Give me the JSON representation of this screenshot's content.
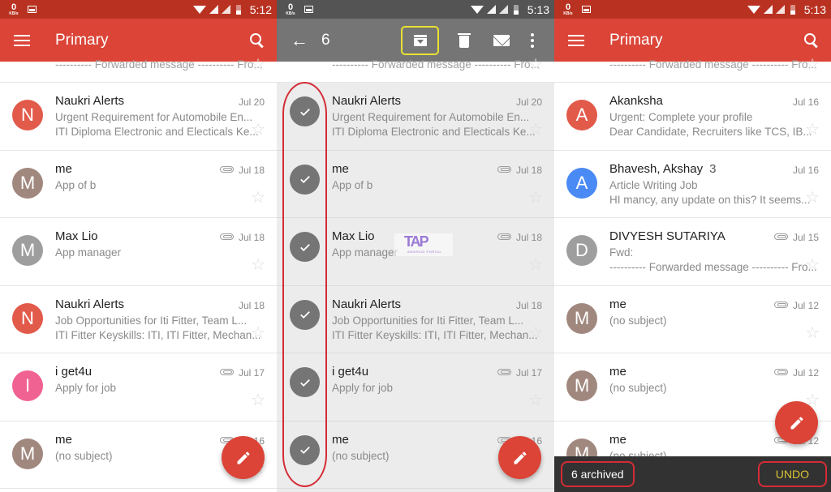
{
  "colors": {
    "primary_red": "#db4437",
    "status_red": "#b93221",
    "selection_gray": "#757575",
    "highlight_yellow": "#e8e231",
    "annotation_red": "#d42c36",
    "undo_yellow": "#d8c232"
  },
  "screens": [
    {
      "status": {
        "net_speed": "0",
        "net_unit": "KB/s",
        "time": "5:12"
      },
      "appbar": {
        "title": "Primary",
        "menu_icon": "hamburger-menu-icon",
        "search_icon": "search-icon"
      },
      "peek": {
        "text": "---------- Forwarded message ---------- Fro..."
      },
      "rows": [
        {
          "initial": "N",
          "color": "#e25a4a",
          "sender": "Naukri Alerts",
          "date": "Jul 20",
          "attachment": false,
          "subject": "Urgent Requirement for Automobile En...",
          "snippet": "ITI Diploma Electronic and Electicals Ke..."
        },
        {
          "initial": "M",
          "color": "#a1887f",
          "sender": "me",
          "date": "Jul 18",
          "attachment": true,
          "subject": "App of b",
          "snippet": ""
        },
        {
          "initial": "M",
          "color": "#9e9e9e",
          "sender": "Max Lio",
          "date": "Jul 18",
          "attachment": true,
          "subject": "App manager",
          "snippet": ""
        },
        {
          "initial": "N",
          "color": "#e25a4a",
          "sender": "Naukri Alerts",
          "date": "Jul 18",
          "attachment": false,
          "subject": "Job Opportunities for Iti Fitter, Team L...",
          "snippet": "ITI Fitter Keyskills: ITI, ITI Fitter, Mechan..."
        },
        {
          "initial": "I",
          "color": "#f06292",
          "sender": "i get4u",
          "date": "Jul 17",
          "attachment": true,
          "subject": "Apply for job",
          "snippet": ""
        },
        {
          "initial": "M",
          "color": "#a1887f",
          "sender": "me",
          "date": "Jul 16",
          "attachment": true,
          "subject": "(no subject)",
          "snippet": ""
        }
      ]
    },
    {
      "status": {
        "net_speed": "0",
        "net_unit": "KB/s",
        "time": "5:13"
      },
      "appbar": {
        "selected_count": "6",
        "back_icon": "arrow-back-icon",
        "actions": [
          "archive-icon",
          "delete-icon",
          "mark-unread-icon",
          "more-vert-icon"
        ]
      },
      "peek": {
        "text": "---------- Forwarded message ---------- Fro..."
      },
      "watermark": {
        "big": "TAP",
        "small": "ANDROID PORTAL"
      },
      "rows": [
        {
          "selected": true,
          "sender": "Naukri Alerts",
          "date": "Jul 20",
          "attachment": false,
          "subject": "Urgent Requirement for Automobile En...",
          "snippet": "ITI Diploma Electronic and Electicals Ke..."
        },
        {
          "selected": true,
          "sender": "me",
          "date": "Jul 18",
          "attachment": true,
          "subject": "App of b",
          "snippet": ""
        },
        {
          "selected": true,
          "sender": "Max Lio",
          "date": "Jul 18",
          "attachment": true,
          "subject": "App manager",
          "snippet": ""
        },
        {
          "selected": true,
          "sender": "Naukri Alerts",
          "date": "Jul 18",
          "attachment": false,
          "subject": "Job Opportunities for Iti Fitter, Team L...",
          "snippet": "ITI Fitter Keyskills: ITI, ITI Fitter, Mechan..."
        },
        {
          "selected": true,
          "sender": "i get4u",
          "date": "Jul 17",
          "attachment": true,
          "subject": "Apply for job",
          "snippet": ""
        },
        {
          "selected": true,
          "sender": "me",
          "date": "Jul 16",
          "attachment": true,
          "subject": "(no subject)",
          "snippet": ""
        }
      ]
    },
    {
      "status": {
        "net_speed": "0",
        "net_unit": "KB/s",
        "time": "5:13"
      },
      "appbar": {
        "title": "Primary",
        "menu_icon": "hamburger-menu-icon",
        "search_icon": "search-icon"
      },
      "peek": {
        "text": "---------- Forwarded message ---------- Fro..."
      },
      "rows": [
        {
          "initial": "A",
          "color": "#e25a4a",
          "sender": "Akanksha",
          "count": "",
          "date": "Jul 16",
          "attachment": false,
          "subject": "Urgent: Complete your profile",
          "snippet": "Dear Candidate, Recruiters like TCS, IB..."
        },
        {
          "initial": "A",
          "color": "#4a8af4",
          "sender": "Bhavesh, Akshay",
          "count": "3",
          "date": "Jul 16",
          "attachment": false,
          "subject": "Article Writing Job",
          "snippet": "HI mancy, any update on this? It seems..."
        },
        {
          "initial": "D",
          "color": "#9e9e9e",
          "sender": "DIVYESH SUTARIYA",
          "count": "",
          "date": "Jul 15",
          "attachment": true,
          "subject": "Fwd:",
          "snippet": "---------- Forwarded message ---------- Fro..."
        },
        {
          "initial": "M",
          "color": "#a1887f",
          "sender": "me",
          "count": "",
          "date": "Jul 12",
          "attachment": true,
          "subject": "(no subject)",
          "snippet": ""
        },
        {
          "initial": "M",
          "color": "#a1887f",
          "sender": "me",
          "count": "",
          "date": "Jul 12",
          "attachment": true,
          "subject": "(no subject)",
          "snippet": ""
        },
        {
          "initial": "M",
          "color": "#a1887f",
          "sender": "me",
          "count": "",
          "date": "Jul 12",
          "attachment": true,
          "subject": "(no subject)",
          "snippet": ""
        }
      ],
      "snackbar": {
        "message": "6 archived",
        "action": "UNDO"
      }
    }
  ],
  "fab": {
    "icon": "compose-pencil-icon"
  }
}
